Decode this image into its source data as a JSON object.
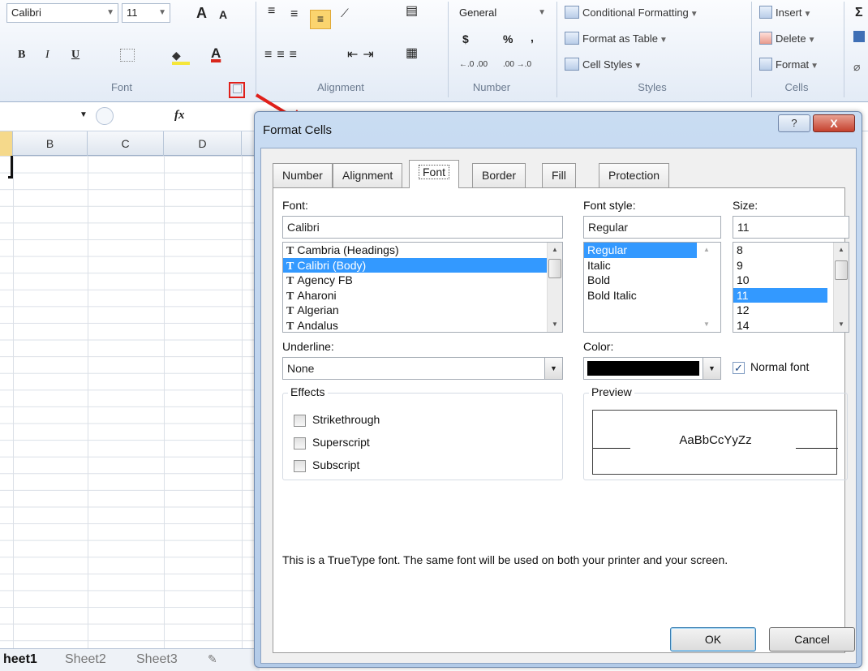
{
  "ribbon": {
    "font_name": "Calibri",
    "font_size": "11",
    "grow_font": "A",
    "shrink_font": "A",
    "bold": "B",
    "italic": "I",
    "underline": "U",
    "font_color": "A",
    "number_format": "General",
    "currency": "$",
    "percent": "%",
    "comma": ",",
    "inc_decimal": "←.0 .00",
    "dec_decimal": ".00 →.0",
    "conditional_formatting": "Conditional Formatting",
    "format_as_table": "Format as Table",
    "cell_styles": "Cell Styles",
    "insert": "Insert",
    "delete": "Delete",
    "format": "Format",
    "sigma": "Σ",
    "groups": {
      "font": "Font",
      "alignment": "Alignment",
      "number": "Number",
      "styles": "Styles",
      "cells": "Cells"
    }
  },
  "formula_bar": {
    "fx": "fx"
  },
  "grid": {
    "columns": [
      "B",
      "C",
      "D"
    ]
  },
  "sheet_tabs": [
    "heet1",
    "Sheet2",
    "Sheet3"
  ],
  "dialog": {
    "title": "Format Cells",
    "help": "?",
    "close": "X",
    "tabs": [
      "Number",
      "Alignment",
      "Font",
      "Border",
      "Fill",
      "Protection"
    ],
    "active_tab": "Font",
    "font_label": "Font:",
    "font_value": "Calibri",
    "font_list": [
      "Cambria (Headings)",
      "Calibri (Body)",
      "Agency FB",
      "Aharoni",
      "Algerian",
      "Andalus"
    ],
    "font_style_label": "Font style:",
    "font_style_value": "Regular",
    "font_style_list": [
      "Regular",
      "Italic",
      "Bold",
      "Bold Italic"
    ],
    "size_label": "Size:",
    "size_value": "11",
    "size_list": [
      "8",
      "9",
      "10",
      "11",
      "12",
      "14"
    ],
    "underline_label": "Underline:",
    "underline_value": "None",
    "color_label": "Color:",
    "color_value": "#000000",
    "normal_font_label": "Normal font",
    "normal_font_checked": true,
    "effects_label": "Effects",
    "strikethrough": "Strikethrough",
    "superscript": "Superscript",
    "subscript": "Subscript",
    "preview_label": "Preview",
    "preview_text": "AaBbCcYyZz",
    "info_text": "This is a TrueType font.  The same font will be used on both your printer and your screen.",
    "ok": "OK",
    "cancel": "Cancel"
  },
  "colors": {
    "selection": "#3399ff",
    "highlight_marker": "#e0201a",
    "dialog_frame": "#b3cbe8"
  }
}
